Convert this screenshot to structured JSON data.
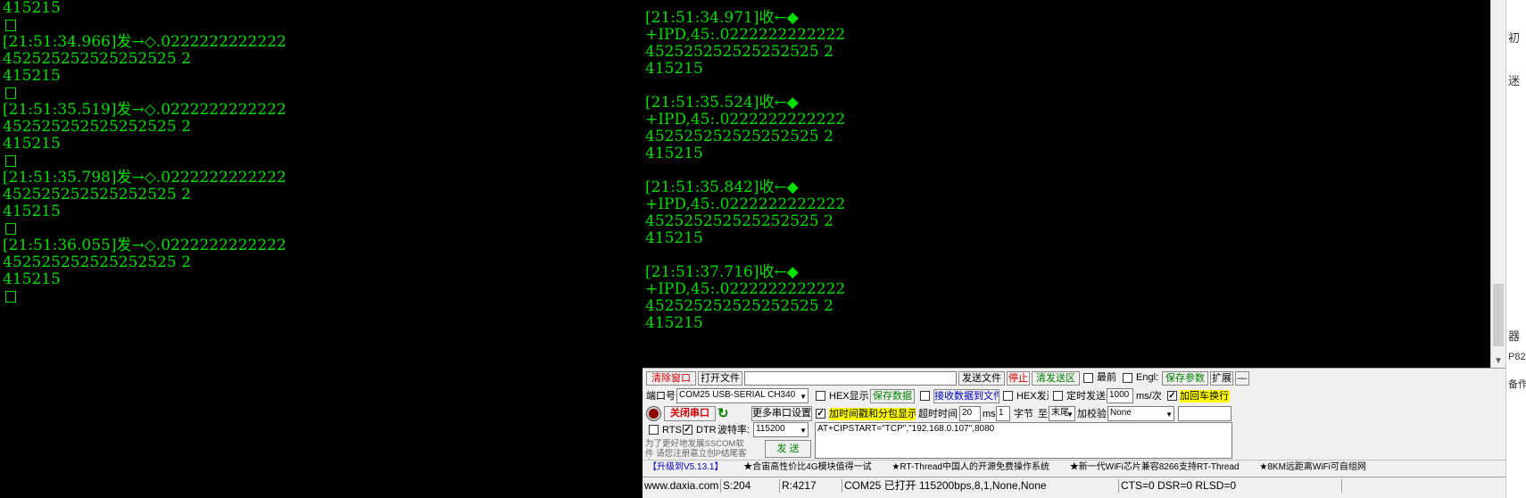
{
  "left_terminal": [
    {
      "text": "415215"
    },
    {
      "box": true
    },
    {
      "text": "[21:51:34.966]发→◇.0222222222222"
    },
    {
      "text": "452525252525252525 2"
    },
    {
      "text": "415215"
    },
    {
      "box": true
    },
    {
      "text": "[21:51:35.519]发→◇.0222222222222"
    },
    {
      "text": "452525252525252525 2"
    },
    {
      "text": "415215"
    },
    {
      "box": true
    },
    {
      "text": "[21:51:35.798]发→◇.0222222222222"
    },
    {
      "text": "452525252525252525 2"
    },
    {
      "text": "415215"
    },
    {
      "box": true
    },
    {
      "text": "[21:51:36.055]发→◇.0222222222222"
    },
    {
      "text": "452525252525252525 2"
    },
    {
      "text": "415215"
    },
    {
      "box": true
    }
  ],
  "right_terminal": [
    {
      "ts": "[21:51:34.971]收←◆",
      "ipd": "+IPD,45:.0222222222222",
      "data": "452525252525252525 2",
      "tail": "415215"
    },
    {
      "ts": "[21:51:35.524]收←◆",
      "ipd": "+IPD,45:.0222222222222",
      "data": "452525252525252525 2",
      "tail": "415215"
    },
    {
      "ts": "[21:51:35.842]收←◆",
      "ipd": "+IPD,45:.0222222222222",
      "data": "452525252525252525 2",
      "tail": "415215"
    },
    {
      "ts": "[21:51:37.716]收←◆",
      "ipd": "+IPD,45:.0222222222222",
      "data": "452525252525252525 2",
      "tail": "415215"
    }
  ],
  "sidebar": {
    "t1": "初",
    "t2": "迷",
    "t3": "器",
    "t4": "P82(",
    "t5": "备作"
  },
  "toolbar": {
    "clear_window": "清除窗口",
    "open_file": "打开文件",
    "send_file": "发送文件",
    "stop": "停止",
    "clear_send": "清发送区",
    "top": "最前",
    "english": "Engl:",
    "save_params": "保存参数",
    "expand": "扩展",
    "collapse": "—"
  },
  "port": {
    "port_label": "端口号",
    "port_value": "COM25 USB-SERIAL CH340",
    "hex_display": "HEX显示",
    "save_data": "保存数据",
    "recv_to_file": "接收数据到文件",
    "hex_send": "HEX发送",
    "timed_send": "定时发送",
    "interval": "1000",
    "interval_unit": "ms/次",
    "add_crlf": "加回车换行",
    "close_port": "关闭串口",
    "more_settings": "更多串口设置",
    "timestamp": "加时间戳和分包显示",
    "timeout_label": "超时时间",
    "timeout_value": "20",
    "ms": "ms",
    "byte_num": "1",
    "byte_label": "字节",
    "to_label": "至",
    "end_value": "末尾",
    "checksum_label": "加校验",
    "checksum_value": "None",
    "rts": "RTS",
    "dtr": "DTR",
    "baud_label": "波特率:",
    "baud_value": "115200",
    "promo": "为了更好地发展SSCOM软件 请您注册嘉立创P结尾客户",
    "send": "发  送",
    "command": "AT+CIPSTART=\"TCP\",\"192.168.0.107\",8080"
  },
  "ticker": [
    "【升级到V5.13.1】",
    "★合宙高性价比4G模块值得一试",
    "★RT-Thread中国人的开源免费操作系统",
    "★新一代WiFi芯片兼容8266支持RT-Thread",
    "★8KM远距离WiFi可自组网"
  ],
  "status": {
    "site": "www.daxia.com",
    "sent": "S:204",
    "recv": "R:4217",
    "port_status": "COM25 已打开  115200bps,8,1,None,None",
    "lines": "CTS=0 DSR=0 RLSD=0"
  }
}
